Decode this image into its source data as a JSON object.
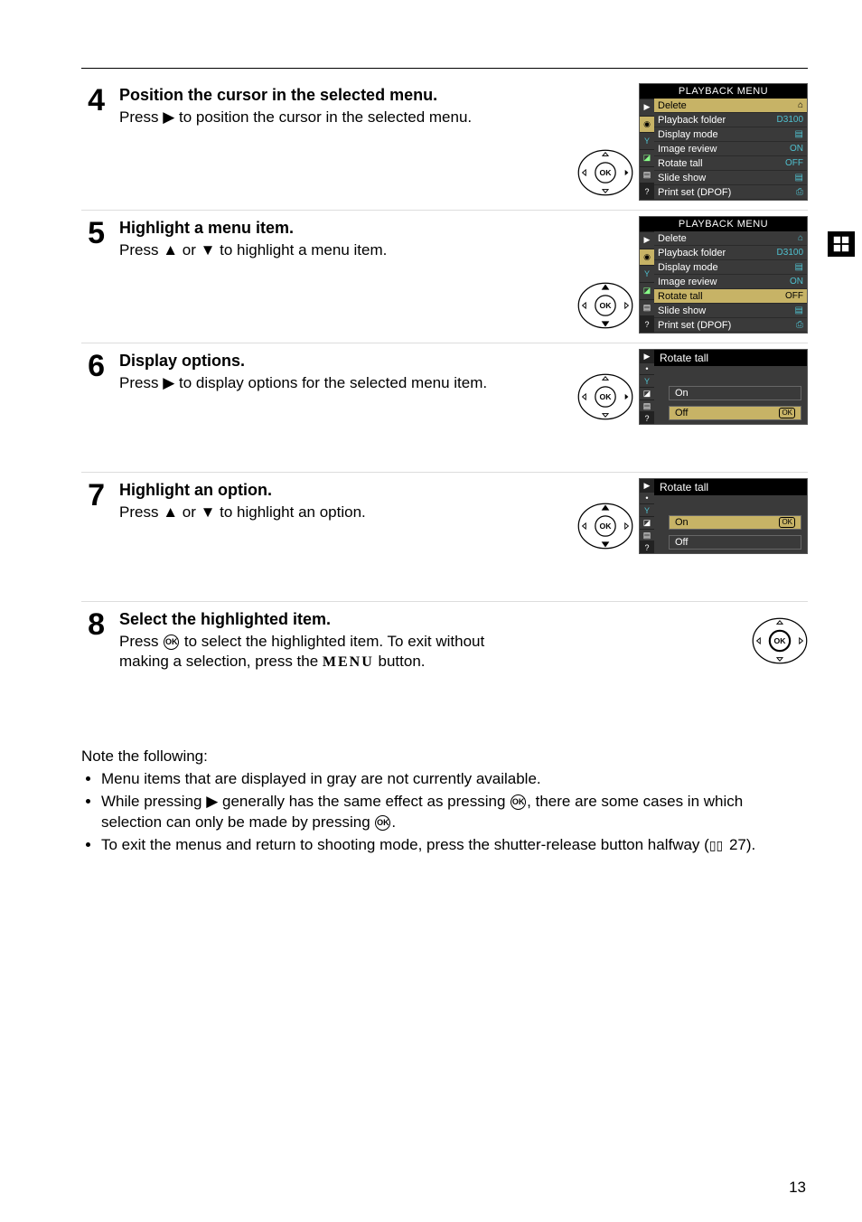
{
  "page_number": "13",
  "menu_label_text": "MENU",
  "steps": [
    {
      "num": "4",
      "title": "Position the cursor in the selected menu.",
      "body_pre": "Press ",
      "arrow": "▶",
      "body_post": " to position the cursor in the selected menu.",
      "pad": "horiz",
      "shot": "playback_delete"
    },
    {
      "num": "5",
      "title": "Highlight a menu item.",
      "body_pre": "Press ",
      "arrow": "▲ or ▼",
      "body_post": " to highlight a menu item.",
      "pad": "vert",
      "shot": "playback_rotate"
    },
    {
      "num": "6",
      "title": "Display options.",
      "body_pre": "Press ",
      "arrow": "▶",
      "body_post": " to display options for the selected menu item.",
      "pad": "horiz",
      "shot": "opt_off"
    },
    {
      "num": "7",
      "title": "Highlight an option.",
      "body_pre": "Press ",
      "arrow": "▲ or ▼",
      "body_post": " to highlight an option.",
      "pad": "vert",
      "shot": "opt_on"
    },
    {
      "num": "8",
      "title": "Select the highlighted item.",
      "body_pre": "Press ",
      "body_mid": " to select the highlighted item.  To exit without making a selection, press the ",
      "body_post": " button.",
      "pad": "all",
      "shot": "none"
    }
  ],
  "playback_menu": {
    "title": "PLAYBACK MENU",
    "items": [
      {
        "label": "Delete",
        "val": "⌂"
      },
      {
        "label": "Playback folder",
        "val": "D3100"
      },
      {
        "label": "Display mode",
        "val": "▤"
      },
      {
        "label": "Image review",
        "val": "ON"
      },
      {
        "label": "Rotate tall",
        "val": "OFF"
      },
      {
        "label": "Slide show",
        "val": "▤"
      },
      {
        "label": "Print set (DPOF)",
        "val": "⎙"
      }
    ],
    "highlight_delete_index": 0,
    "highlight_rotate_index": 4
  },
  "option_menu": {
    "title": "Rotate tall",
    "options": [
      "On",
      "Off"
    ],
    "ok_mark": "OK"
  },
  "notes": {
    "intro": "Note the following:",
    "b1": "Menu items that are displayed in gray are not currently available.",
    "b2_pre": "While pressing ",
    "b2_mid": " generally has the same effect as pressing ",
    "b2_post": ", there are some cases in which selection can only be made by pressing ",
    "b2_end": ".",
    "b3_pre": "To exit the menus and return to shooting mode, press the shutter-release button halfway (",
    "b3_page": " 27).",
    "arrow_right": "▶"
  },
  "icons": {
    "ok_text": "OK"
  }
}
